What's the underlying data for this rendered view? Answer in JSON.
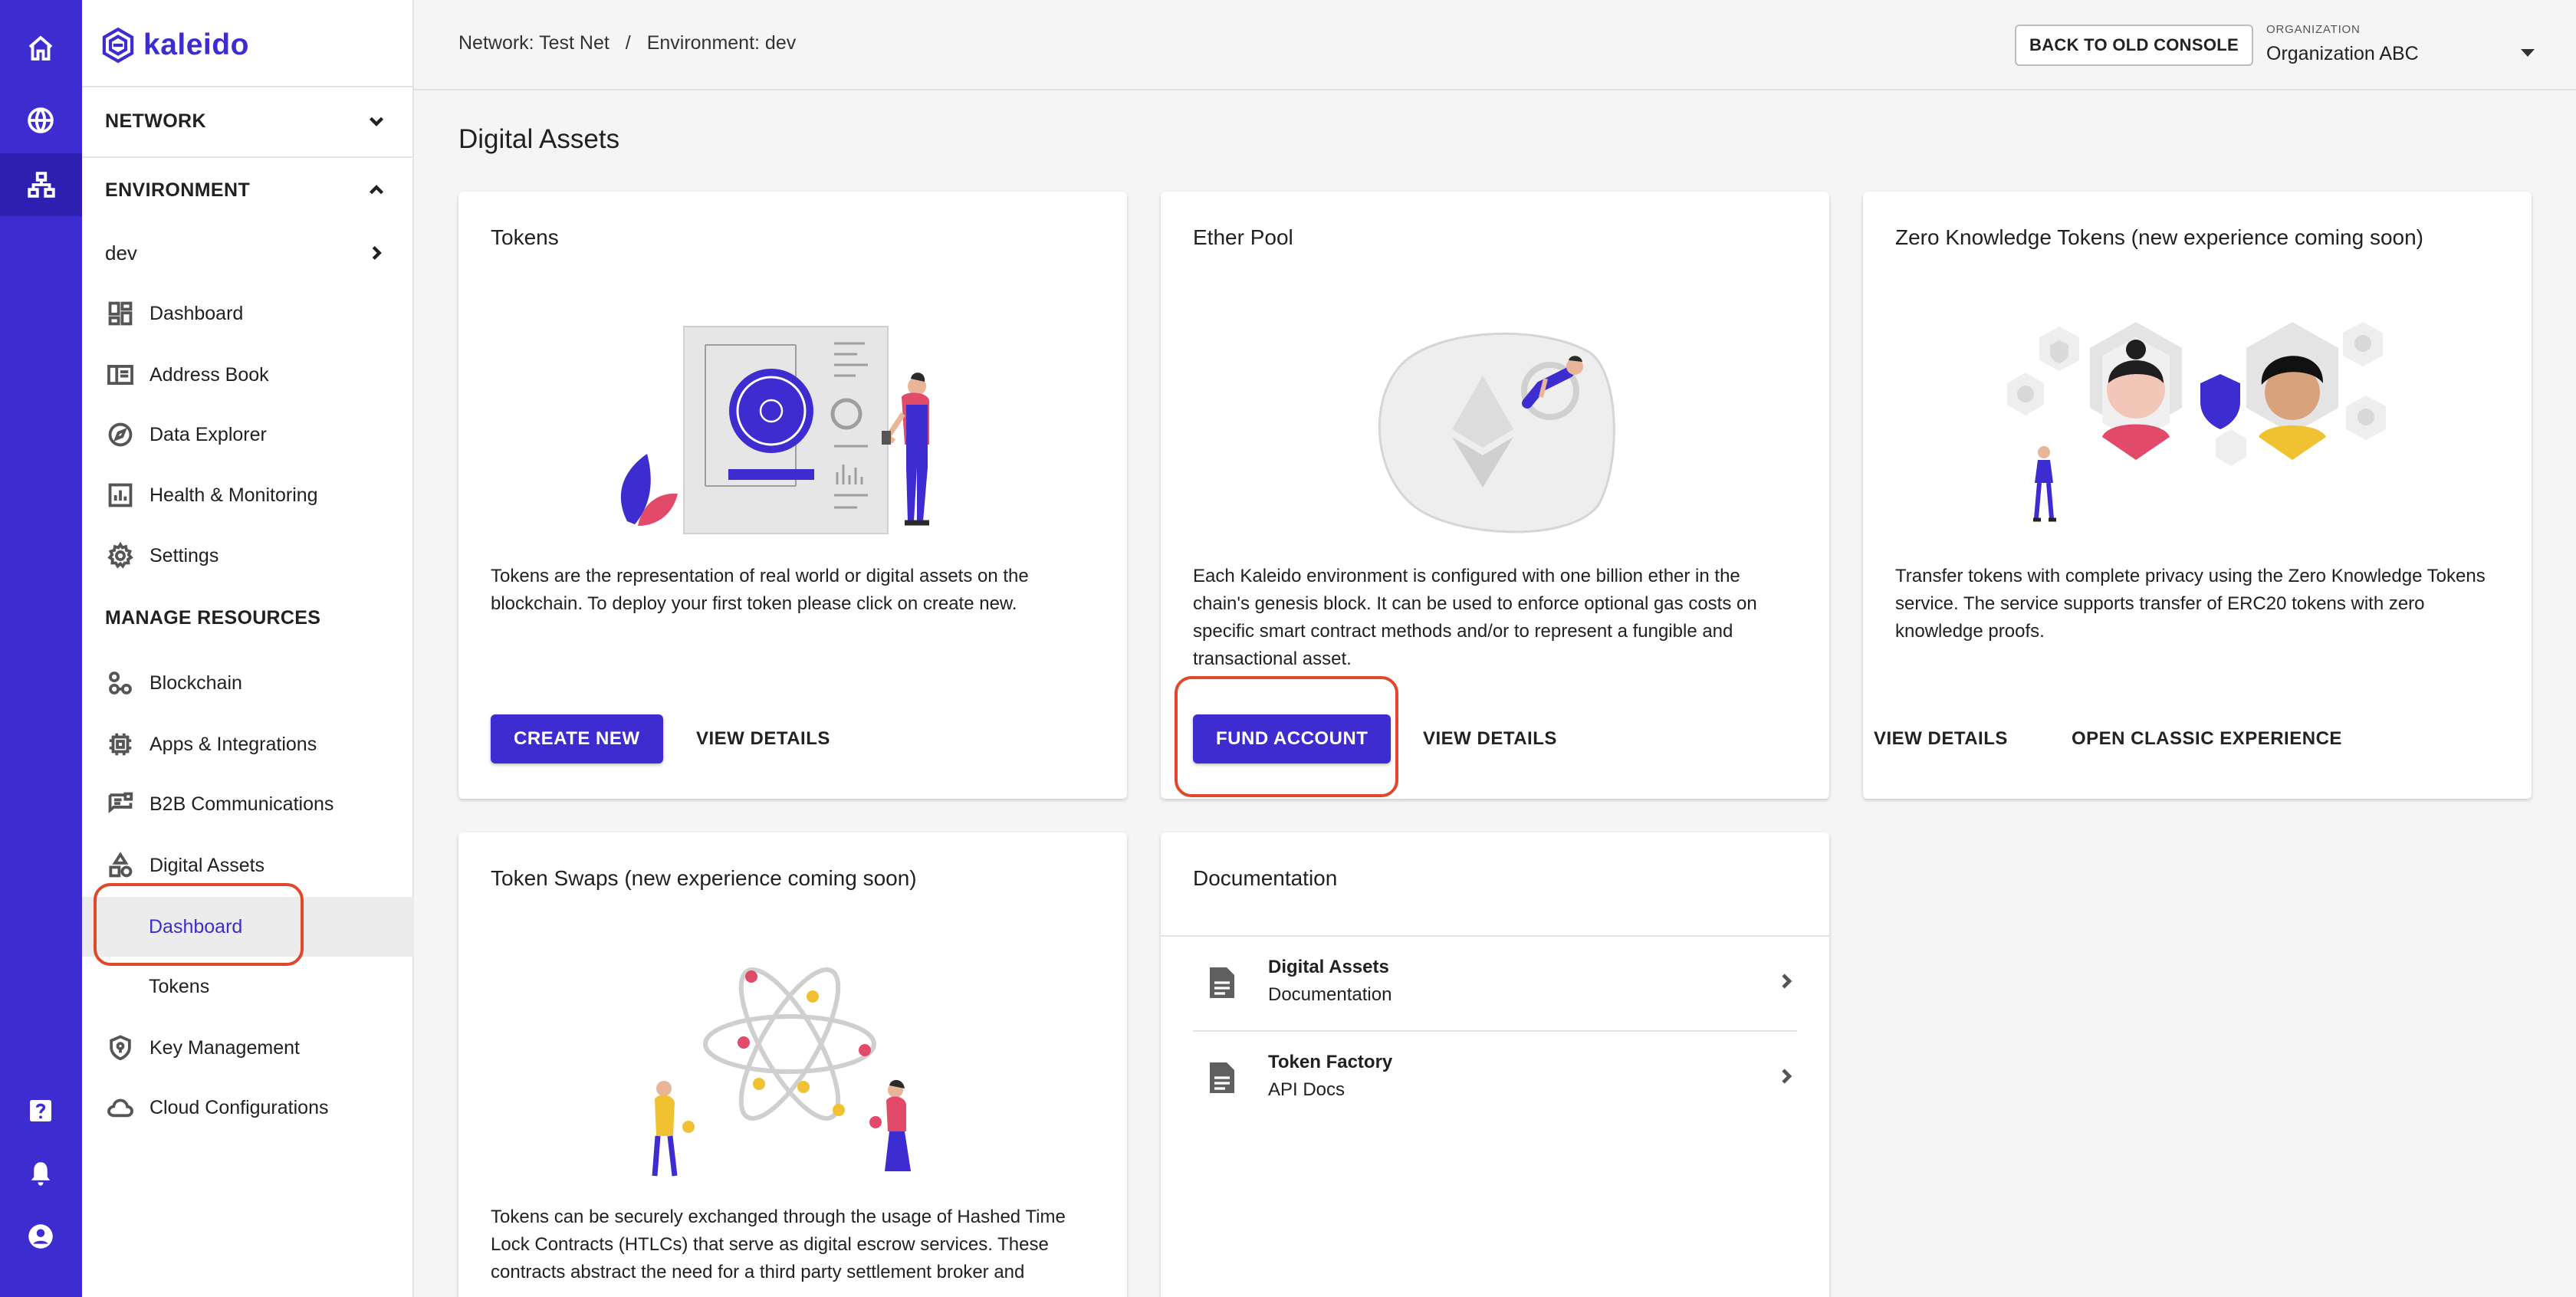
{
  "app": {
    "brand": "kaleido"
  },
  "header": {
    "network_crumb": "Network: Test Net",
    "separator": "/",
    "environment_crumb": "Environment: dev",
    "back_button": "BACK TO OLD CONSOLE",
    "org_label": "ORGANIZATION",
    "org_value": "Organization ABC"
  },
  "rail": {
    "top": [
      "home-icon",
      "globe-icon",
      "network-icon"
    ],
    "bottom": [
      "help-icon",
      "bell-icon",
      "account-icon"
    ]
  },
  "sidebar": {
    "network_label": "NETWORK",
    "environment_label": "ENVIRONMENT",
    "environment_value": "dev",
    "env_items": [
      {
        "label": "Dashboard",
        "icon": "dashboard-icon"
      },
      {
        "label": "Address Book",
        "icon": "address-book-icon"
      },
      {
        "label": "Data Explorer",
        "icon": "compass-icon"
      },
      {
        "label": "Health & Monitoring",
        "icon": "chart-icon"
      },
      {
        "label": "Settings",
        "icon": "gear-icon"
      }
    ],
    "manage_label": "MANAGE RESOURCES",
    "manage_items": [
      {
        "label": "Blockchain",
        "icon": "blockchain-icon"
      },
      {
        "label": "Apps & Integrations",
        "icon": "chip-icon"
      },
      {
        "label": "B2B Communications",
        "icon": "message-icon"
      },
      {
        "label": "Digital Assets",
        "icon": "shapes-icon"
      }
    ],
    "digital_sub": [
      "Dashboard",
      "Tokens"
    ],
    "tail_items": [
      {
        "label": "Key Management",
        "icon": "shield-key-icon"
      },
      {
        "label": "Cloud Configurations",
        "icon": "cloud-icon"
      }
    ]
  },
  "main": {
    "title": "Digital Assets",
    "tokens": {
      "title": "Tokens",
      "text": "Tokens are the representation of real world or digital assets on the blockchain. To deploy your first token please click on create new.",
      "primary": "CREATE NEW",
      "secondary": "VIEW DETAILS"
    },
    "ether": {
      "title": "Ether Pool",
      "text": "Each Kaleido environment is configured with one billion ether in the chain's genesis block. It can be used to enforce optional gas costs on specific smart contract methods and/or to represent a fungible and transactional asset.",
      "primary": "FUND ACCOUNT",
      "secondary": "VIEW DETAILS"
    },
    "zk": {
      "title": "Zero Knowledge Tokens (new experience coming soon)",
      "text": "Transfer tokens with complete privacy using the Zero Knowledge Tokens service. The service supports transfer of ERC20 tokens with zero knowledge proofs.",
      "secondary": "VIEW DETAILS",
      "tertiary": "OPEN CLASSIC EXPERIENCE"
    },
    "swaps": {
      "title": "Token Swaps (new experience coming soon)",
      "text": "Tokens can be securely exchanged through the usage of Hashed Time Lock Contracts (HTLCs) that serve as digital escrow services. These contracts abstract the need for a third party settlement broker and"
    },
    "docs": {
      "title": "Documentation",
      "items": [
        {
          "title": "Digital Assets",
          "sub": "Documentation"
        },
        {
          "title": "Token Factory",
          "sub": "API Docs"
        }
      ]
    }
  },
  "colors": {
    "brand": "#3d2ccf",
    "annotation": "#e0472d"
  }
}
